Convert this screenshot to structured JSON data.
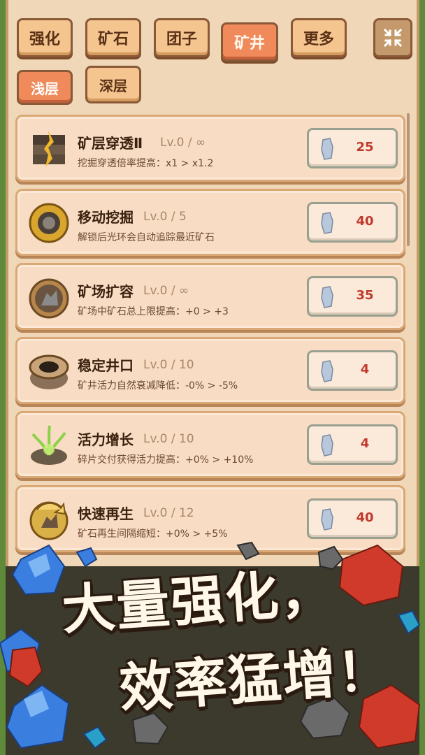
{
  "tabs": [
    {
      "label": "强化"
    },
    {
      "label": "矿石"
    },
    {
      "label": "团子"
    },
    {
      "label": "矿井"
    },
    {
      "label": "更多"
    }
  ],
  "subtabs": [
    {
      "label": "浅层"
    },
    {
      "label": "深层"
    }
  ],
  "upgrades": [
    {
      "title": "矿层穿透Ⅱ",
      "level": "Lv.0 / ∞",
      "desc": "挖掘穿透倍率提高：x1 > x1.2",
      "cost": "25",
      "icon": "layered-ore-icon"
    },
    {
      "title": "移动挖掘",
      "level": "Lv.0 / 5",
      "desc": "解锁后光环会自动追踪最近矿石",
      "cost": "40",
      "icon": "golden-ring-icon"
    },
    {
      "title": "矿场扩容",
      "level": "Lv.0 / ∞",
      "desc": "矿场中矿石总上限提高：+0 > +3",
      "cost": "35",
      "icon": "mine-field-icon"
    },
    {
      "title": "稳定井口",
      "level": "Lv.0 / 10",
      "desc": "矿井活力自然衰减降低：-0% > -5%",
      "cost": "4",
      "icon": "well-icon"
    },
    {
      "title": "活力增长",
      "level": "Lv.0 / 10",
      "desc": "碎片交付获得活力提高：+0% > +10%",
      "cost": "4",
      "icon": "vitality-plant-icon"
    },
    {
      "title": "快速再生",
      "level": "Lv.0 / 12",
      "desc": "矿石再生间隔缩短：+0% > +5%",
      "cost": "40",
      "icon": "regen-cycle-icon"
    }
  ],
  "promo": {
    "line1": "大量强化，",
    "line2": "效率猛增！"
  },
  "colors": {
    "active_tab": "#f08a5a",
    "idle_tab": "#f4c58f",
    "cost_text": "#c0392b",
    "panel": "#efd7b8"
  }
}
